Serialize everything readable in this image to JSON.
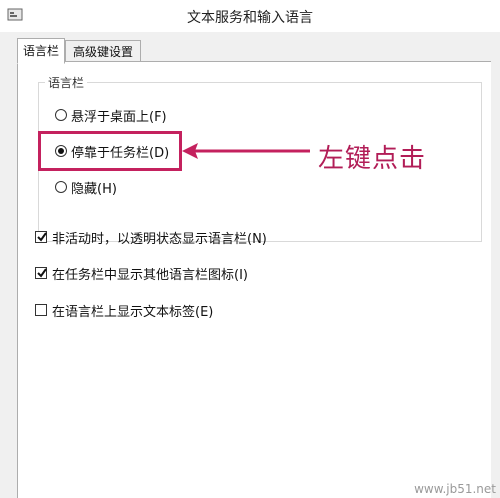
{
  "window": {
    "title": "文本服务和输入语言"
  },
  "tabs": [
    {
      "label": "语言栏",
      "active": true
    },
    {
      "label": "高级键设置",
      "active": false
    }
  ],
  "language_bar_group": {
    "title": "语言栏",
    "options": [
      {
        "label": "悬浮于桌面上(F)",
        "selected": false
      },
      {
        "label": "停靠于任务栏(D)",
        "selected": true
      },
      {
        "label": "隐藏(H)",
        "selected": false
      }
    ]
  },
  "checkboxes": [
    {
      "label": "非活动时，以透明状态显示语言栏(N)",
      "checked": true
    },
    {
      "label": "在任务栏中显示其他语言栏图标(I)",
      "checked": true
    },
    {
      "label": "在语言栏上显示文本标签(E)",
      "checked": false
    }
  ],
  "annotation": {
    "text": "左键点击",
    "color": "#c4215e"
  },
  "watermark": "www.jb51.net"
}
